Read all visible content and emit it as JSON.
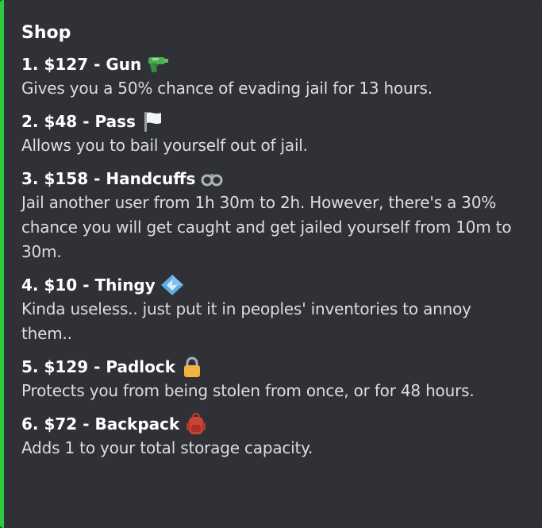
{
  "colors": {
    "accent": "#2ecc40",
    "embed_bg": "#2f3136",
    "title": "#ffffff",
    "desc": "#dcddde"
  },
  "shop": {
    "title": "Shop",
    "items": [
      {
        "name": "1. $127 - Gun",
        "icon": "water-pistol-icon",
        "description": "Gives you a 50% chance of evading jail for 13 hours."
      },
      {
        "name": "2. $48 - Pass",
        "icon": "white-flag-icon",
        "description": "Allows you to bail yourself out of jail."
      },
      {
        "name": "3. $158 - Handcuffs",
        "icon": "handcuffs-icon",
        "description": "Jail another user from 1h 30m to 2h. However, there's a 30% chance you will get caught and get jailed yourself from 10m to 30m."
      },
      {
        "name": "4. $10 - Thingy",
        "icon": "diamond-shape-icon",
        "description": "Kinda useless.. just put it in peoples' inventories to annoy them.."
      },
      {
        "name": "5. $129 - Padlock",
        "icon": "lock-icon",
        "description": "Protects you from being stolen from once, or for 48 hours."
      },
      {
        "name": "6. $72 - Backpack",
        "icon": "backpack-icon",
        "description": "Adds 1 to your total storage capacity."
      }
    ]
  }
}
